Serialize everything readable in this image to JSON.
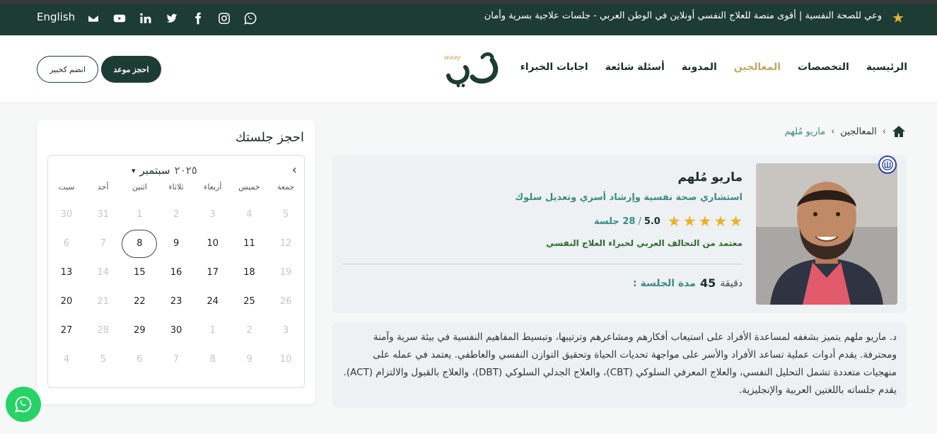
{
  "topbar": {
    "tagline": "وعي للصحة النفسية | أقوى منصة للعلاج النفسي أونلاين في الوطن العربي - جلسات علاجية بسرية وأمان",
    "language": "English",
    "socials": [
      "email-icon",
      "youtube-icon",
      "linkedin-icon",
      "twitter-icon",
      "facebook-icon",
      "instagram-icon",
      "whatsapp-icon"
    ]
  },
  "nav": {
    "items": [
      {
        "label": "الرئيسية",
        "active": false
      },
      {
        "label": "التخصصات",
        "active": false
      },
      {
        "label": "المعالجين",
        "active": true
      },
      {
        "label": "المدونة",
        "active": false
      },
      {
        "label": "أسئلة شائعة",
        "active": false
      },
      {
        "label": "اجابات الخبراء",
        "active": false
      }
    ],
    "book_label": "احجز موعد",
    "join_label": "انضم كخبير",
    "logo_text": "وعي",
    "logo_sub": "waay"
  },
  "breadcrumb": {
    "items": [
      "المعالجين",
      "ماريو مُلهم"
    ]
  },
  "profile": {
    "name": "ماريو مُلهم",
    "title": "استشاري صحة نفسية وإرشاد أسري وتعديل سلوك",
    "rating": "5.0",
    "sessions": "28 جلسة",
    "stars": 5,
    "accreditation": "معتمد من التحالف العربي لخبراء العلاج النفسي",
    "duration_label": "مدة الجلسة :",
    "duration_value": "45",
    "duration_unit": "دقيقة"
  },
  "bio": {
    "text": "د. ماريو ملهم يتميز بشغفه لمساعدة الأفراد على استيعاب أفكارهم ومشاعرهم وترتيبها، وتبسيط المفاهيم النفسية في بيئة سرية وآمنة ومحترفة. يقدم أدوات عملية تساعد الأفراد والأسر على مواجهة تحديات الحياة وتحقيق التوازن النفسي والعاطفي. يعتمد في عمله على منهجيات متعددة تشمل التحليل النفسي، والعلاج المعرفي السلوكي (CBT)، والعلاج الجدلي السلوكي (DBT)، والعلاج بالقبول والالتزام (ACT). يقدم جلساته باللغتين العربية والإنجليزية."
  },
  "calendar": {
    "title": "احجز جلستك",
    "month": "سبتمبر",
    "year": "٢٠٢٥",
    "weekdays": [
      "جمعة",
      "خميس",
      "أربعاء",
      "ثلاثاء",
      "اثنين",
      "أحد",
      "سبت"
    ],
    "weeks": [
      [
        {
          "d": "5",
          "m": true
        },
        {
          "d": "4",
          "m": true
        },
        {
          "d": "3",
          "m": true
        },
        {
          "d": "2",
          "m": true
        },
        {
          "d": "1",
          "m": true
        },
        {
          "d": "31",
          "m": true
        },
        {
          "d": "30",
          "m": true
        }
      ],
      [
        {
          "d": "12",
          "m": true
        },
        {
          "d": "11",
          "m": false
        },
        {
          "d": "10",
          "m": false
        },
        {
          "d": "9",
          "m": false
        },
        {
          "d": "8",
          "m": false,
          "today": true
        },
        {
          "d": "7",
          "m": true
        },
        {
          "d": "6",
          "m": true
        }
      ],
      [
        {
          "d": "19",
          "m": true
        },
        {
          "d": "18",
          "m": false
        },
        {
          "d": "17",
          "m": false
        },
        {
          "d": "16",
          "m": false
        },
        {
          "d": "15",
          "m": false
        },
        {
          "d": "14",
          "m": true
        },
        {
          "d": "13",
          "m": false
        }
      ],
      [
        {
          "d": "26",
          "m": true
        },
        {
          "d": "25",
          "m": false
        },
        {
          "d": "24",
          "m": false
        },
        {
          "d": "23",
          "m": false
        },
        {
          "d": "22",
          "m": false
        },
        {
          "d": "21",
          "m": true
        },
        {
          "d": "20",
          "m": false
        }
      ],
      [
        {
          "d": "3",
          "m": true
        },
        {
          "d": "2",
          "m": true
        },
        {
          "d": "1",
          "m": true
        },
        {
          "d": "30",
          "m": false
        },
        {
          "d": "29",
          "m": false
        },
        {
          "d": "28",
          "m": true
        },
        {
          "d": "27",
          "m": false
        }
      ],
      [
        {
          "d": "10",
          "m": true
        },
        {
          "d": "9",
          "m": true
        },
        {
          "d": "8",
          "m": true
        },
        {
          "d": "7",
          "m": true
        },
        {
          "d": "6",
          "m": true
        },
        {
          "d": "5",
          "m": true
        },
        {
          "d": "4",
          "m": true
        }
      ]
    ]
  },
  "colors": {
    "brand_dark": "#1d3c34",
    "accent_gold": "#c7a560",
    "teal": "#3b8c84",
    "star": "#e8b32b",
    "whatsapp": "#25d366"
  }
}
